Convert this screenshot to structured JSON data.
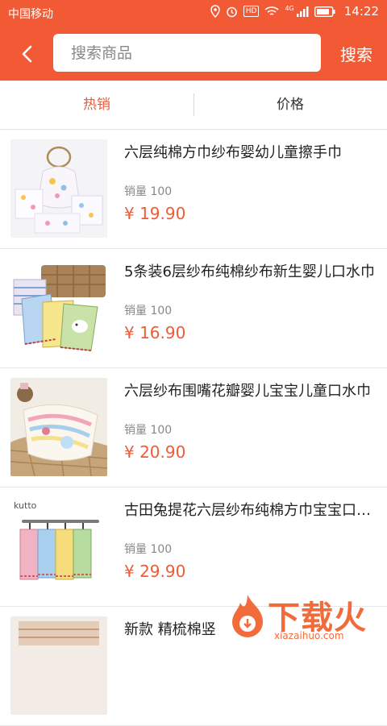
{
  "status_bar": {
    "carrier": "中国移动",
    "hd_badge": "HD",
    "network": "4G",
    "time": "14:22"
  },
  "header": {
    "search_placeholder": "搜索商品",
    "search_button": "搜索"
  },
  "tabs": [
    {
      "label": "热销",
      "active": true
    },
    {
      "label": "价格",
      "active": false
    }
  ],
  "products": [
    {
      "title": "六层纯棉方巾纱布婴幼儿童擦手巾",
      "sales": "销量 100",
      "price": "¥  19.90"
    },
    {
      "title": "5条装6层纱布纯棉纱布新生婴儿口水巾",
      "sales": "销量 100",
      "price": "¥  16.90"
    },
    {
      "title": "六层纱布围嘴花瓣婴儿宝宝儿童口水巾",
      "sales": "销量 100",
      "price": "¥  20.90"
    },
    {
      "title": "古田兔提花六层纱布纯棉方巾宝宝口水巾",
      "sales": "销量 100",
      "price": "¥  29.90"
    },
    {
      "title": "新款 精梳棉竖",
      "sales": "",
      "price": ""
    }
  ],
  "watermark": {
    "text": "下载火",
    "url_text": "xiazaihuo.com"
  },
  "colors": {
    "accent": "#f15a35"
  }
}
